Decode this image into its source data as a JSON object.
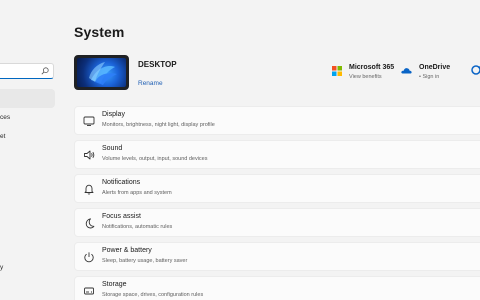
{
  "nav": {
    "items": [
      {
        "label": "ces"
      },
      {
        "label": "et"
      },
      {
        "label": "y"
      }
    ]
  },
  "page": {
    "title": "System"
  },
  "device": {
    "name": "DESKTOP",
    "rename_label": "Rename"
  },
  "services": [
    {
      "title": "Microsoft 365",
      "subtitle": "View benefits"
    },
    {
      "title": "OneDrive",
      "subtitle": "• Sign in"
    }
  ],
  "settings": [
    {
      "title": "Display",
      "desc": "Monitors, brightness, night light, display profile",
      "icon": "monitor-icon"
    },
    {
      "title": "Sound",
      "desc": "Volume levels, output, input, sound devices",
      "icon": "speaker-icon"
    },
    {
      "title": "Notifications",
      "desc": "Alerts from apps and system",
      "icon": "bell-icon"
    },
    {
      "title": "Focus assist",
      "desc": "Notifications, automatic rules",
      "icon": "moon-icon"
    },
    {
      "title": "Power & battery",
      "desc": "Sleep, battery usage, battery saver",
      "icon": "power-icon"
    },
    {
      "title": "Storage",
      "desc": "Storage space, drives, configuration rules",
      "icon": "storage-icon"
    }
  ],
  "colors": {
    "accent": "#0067c0",
    "link": "#1f5fb4",
    "background": "#f3f3f3",
    "card": "#fbfbfb"
  }
}
